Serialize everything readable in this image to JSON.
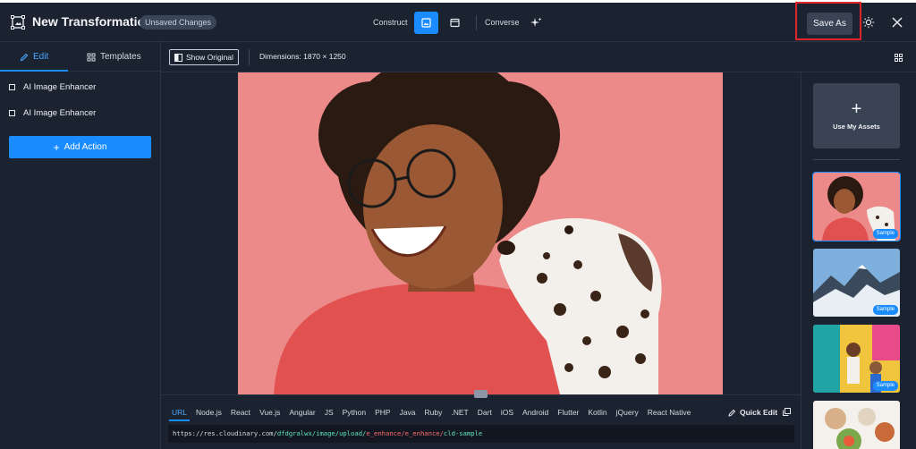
{
  "header": {
    "title": "New Transformation",
    "badge": "Unsaved Changes",
    "construct_label": "Construct",
    "converse_label": "Converse",
    "save_as_label": "Save As"
  },
  "left_panel": {
    "tabs": [
      {
        "label": "Edit",
        "active": true
      },
      {
        "label": "Templates",
        "active": false
      }
    ],
    "actions": [
      "AI Image Enhancer",
      "AI Image Enhancer"
    ],
    "add_action_label": "Add Action"
  },
  "toolbar": {
    "show_original_label": "Show Original",
    "dimensions_text": "Dimensions: 1870 × 1250"
  },
  "code": {
    "languages": [
      "URL",
      "Node.js",
      "React",
      "Vue.js",
      "Angular",
      "JS",
      "Python",
      "PHP",
      "Java",
      "Ruby",
      ".NET",
      "Dart",
      "iOS",
      "Android",
      "Flutter",
      "Kotlin",
      "jQuery",
      "React Native"
    ],
    "active_language": "URL",
    "quick_edit_label": "Quick Edit",
    "url_base": "https://res.cloudinary.com/",
    "url_cloud": "dfdgralwx/image/upload/",
    "url_transform": "e_enhance/e_enhance/",
    "url_asset": "cld-sample"
  },
  "right_panel": {
    "use_assets_label": "Use My Assets",
    "thumbnails": [
      {
        "badge": "Sample",
        "selected": true
      },
      {
        "badge": "Sample",
        "selected": false
      },
      {
        "badge": "Sample",
        "selected": false
      },
      {
        "badge": "",
        "selected": false
      }
    ]
  },
  "colors": {
    "background": "#1b2230",
    "accent": "#1a8cff",
    "highlight_box": "#e0252a"
  }
}
